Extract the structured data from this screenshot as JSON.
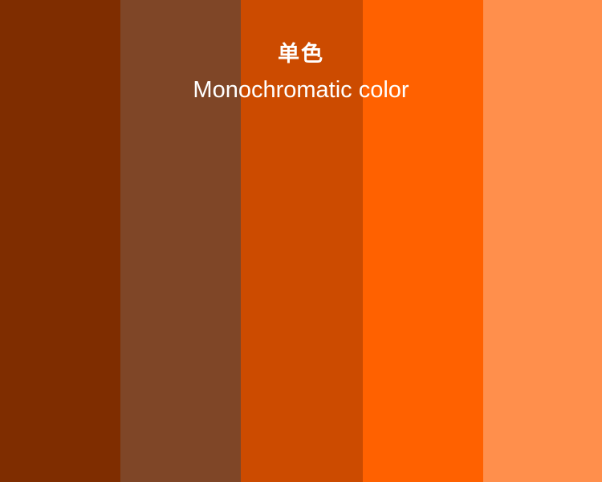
{
  "title": {
    "zh": "单色",
    "en": "Monochromatic color"
  },
  "text_color": "#ffffff",
  "swatches": [
    {
      "color": "#7f2d00"
    },
    {
      "color": "#7f4627"
    },
    {
      "color": "#cc4b00"
    },
    {
      "color": "#ff6100"
    },
    {
      "color": "#ff8f4c"
    }
  ]
}
